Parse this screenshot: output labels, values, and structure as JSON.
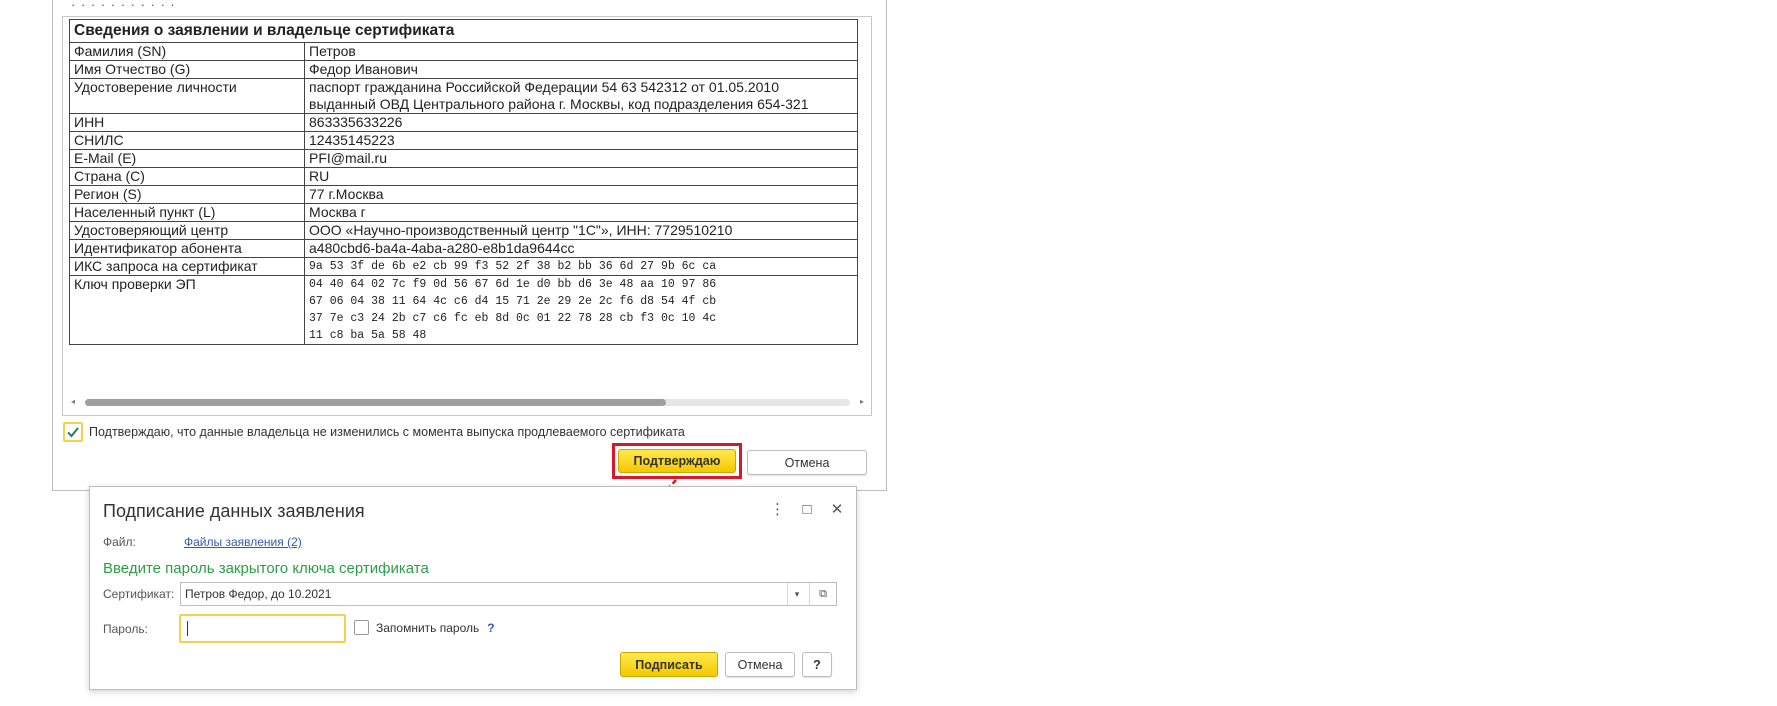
{
  "top_cut_text": "·  ·  ·  ·  ·    ·  ·  ·  ·  ·  ·",
  "cert_table": {
    "title": "Сведения о заявлении и владельце сертификата",
    "rows": [
      {
        "label": "Фамилия (SN)",
        "value": "Петров"
      },
      {
        "label": "Имя Отчество (G)",
        "value": "Федор Иванович"
      },
      {
        "label": "Удостоверение личности",
        "lines": [
          "паспорт гражданина Российской Федерации 54 63 542312 от 01.05.2010",
          "выданный ОВД Центрального района г. Москвы, код подразделения 654-321"
        ]
      },
      {
        "label": "ИНН",
        "value": "863335633226"
      },
      {
        "label": "СНИЛС",
        "value": "12435145223"
      },
      {
        "label": "E-Mail (E)",
        "value": "PFI@mail.ru"
      },
      {
        "label": "Страна (C)",
        "value": "RU"
      },
      {
        "label": "Регион (S)",
        "value": "77 г.Москва"
      },
      {
        "label": "Населенный пункт (L)",
        "value": "Москва г"
      },
      {
        "label": "Удостоверяющий центр",
        "value": "ООО «Научно-производственный центр \"1С\"», ИНН: 7729510210"
      },
      {
        "label": "Идентификатор абонента",
        "value": "a480cbd6-ba4a-4aba-a280-e8b1da9644cc"
      },
      {
        "label": "ИКС запроса на сертификат",
        "value": "9a 53 3f de 6b e2 cb 99 f3 52 2f 38 b2 bb 36 6d 27 9b 6c ca"
      },
      {
        "label": "Ключ проверки ЭП",
        "lines": [
          "04 40 64 02 7c f9 0d 56 67 6d 1e d0 bb d6 3e 48 aa 10 97 86",
          "67 06 04 38 11 64 4c c6 d4 15 71 2e 29 2e 2c f6 d8 54 4f cb",
          "37 7e c3 24 2b c7 c6 fc eb 8d 0c 01 22 78 28 cb f3 0c 10 4c",
          "11 c8 ba 5a 58 48"
        ]
      }
    ]
  },
  "scrollbar": {
    "position": 0.76
  },
  "confirm_checkbox": {
    "label": "Подтверждаю, что данные владельца не изменились с момента выпуска продлеваемого сертификата",
    "checked": true
  },
  "buttons": {
    "confirm": "Подтверждаю",
    "cancel": "Отмена"
  },
  "colors": {
    "accent_yellow": "#f5c800",
    "highlight_red": "#d6182a",
    "hint_green": "#2d9e46",
    "link_blue": "#2f5ea9"
  },
  "dialog": {
    "title": "Подписание данных заявления",
    "controls": {
      "more": "⋮",
      "maximize": "□",
      "close": "✕"
    },
    "file_label": "Файл:",
    "file_link": "Файлы заявления (2)",
    "hint": "Введите пароль закрытого ключа сертификата",
    "certificate_label": "Сертификат:",
    "certificate_value": "Петров Федор, до 10.2021",
    "password_label": "Пароль:",
    "password_value": "",
    "remember_label": "Запомнить пароль",
    "help": "?",
    "sign_button": "Подписать",
    "cancel_button": "Отмена",
    "help_button": "?"
  }
}
